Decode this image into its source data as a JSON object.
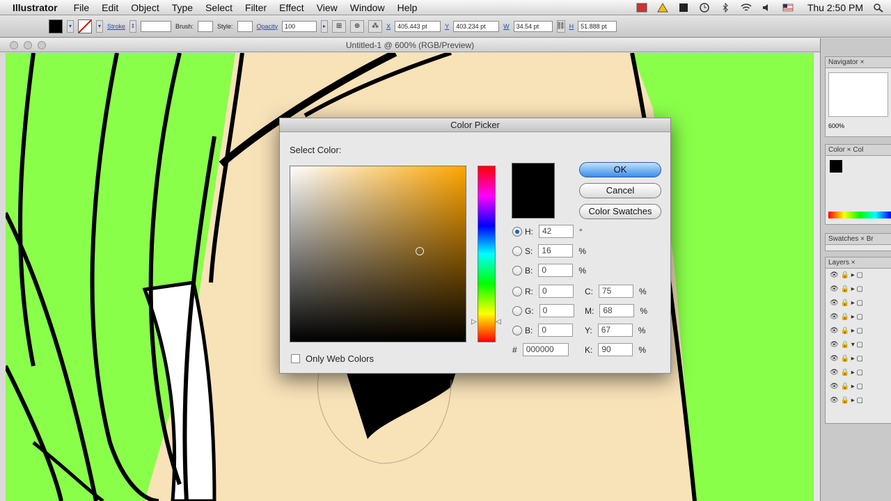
{
  "menubar": {
    "app": "Illustrator",
    "items": [
      "File",
      "Edit",
      "Object",
      "Type",
      "Select",
      "Filter",
      "Effect",
      "View",
      "Window",
      "Help"
    ],
    "clock": "Thu 2:50 PM"
  },
  "controlbar": {
    "stroke_label": "Stroke",
    "brush_label": "Brush:",
    "style_label": "Style:",
    "opacity_label": "Opacity",
    "opacity_value": "100",
    "x_label": "X",
    "x_value": "405.443 pt",
    "y_label": "Y",
    "y_value": "403.234 pt",
    "w_label": "W",
    "w_value": "34.54 pt",
    "h_label": "H",
    "h_value": "51.888 pt"
  },
  "document": {
    "title": "Untitled-1 @ 600% (RGB/Preview)"
  },
  "panels": {
    "navigator": "Navigator",
    "zoom": "600%",
    "color": "Color",
    "color_tab2": "Col",
    "swatches": "Swatches",
    "swatches_tab2": "Br",
    "layers": "Layers"
  },
  "dialog": {
    "title": "Color Picker",
    "select_color": "Select Color:",
    "ok": "OK",
    "cancel": "Cancel",
    "swatches": "Color Swatches",
    "h_label": "H:",
    "h_value": "42",
    "h_unit": "°",
    "s_label": "S:",
    "s_value": "16",
    "s_unit": "%",
    "b_label": "B:",
    "b_value": "0",
    "b_unit": "%",
    "r_label": "R:",
    "r_value": "0",
    "g_label": "G:",
    "g_value": "0",
    "bl_label": "B:",
    "bl_value": "0",
    "c_label": "C:",
    "c_value": "75",
    "c_unit": "%",
    "m_label": "M:",
    "m_value": "68",
    "m_unit": "%",
    "y_label": "Y:",
    "y_value": "67",
    "y_unit": "%",
    "k_label": "K:",
    "k_value": "90",
    "k_unit": "%",
    "hex_label": "#",
    "hex_value": "000000",
    "web_colors": "Only Web Colors"
  },
  "colors": {
    "canvas_green": "#8aff4a",
    "skin": "#f8e2b8",
    "hue_selected": "#ffa500",
    "current_color": "#000000"
  }
}
